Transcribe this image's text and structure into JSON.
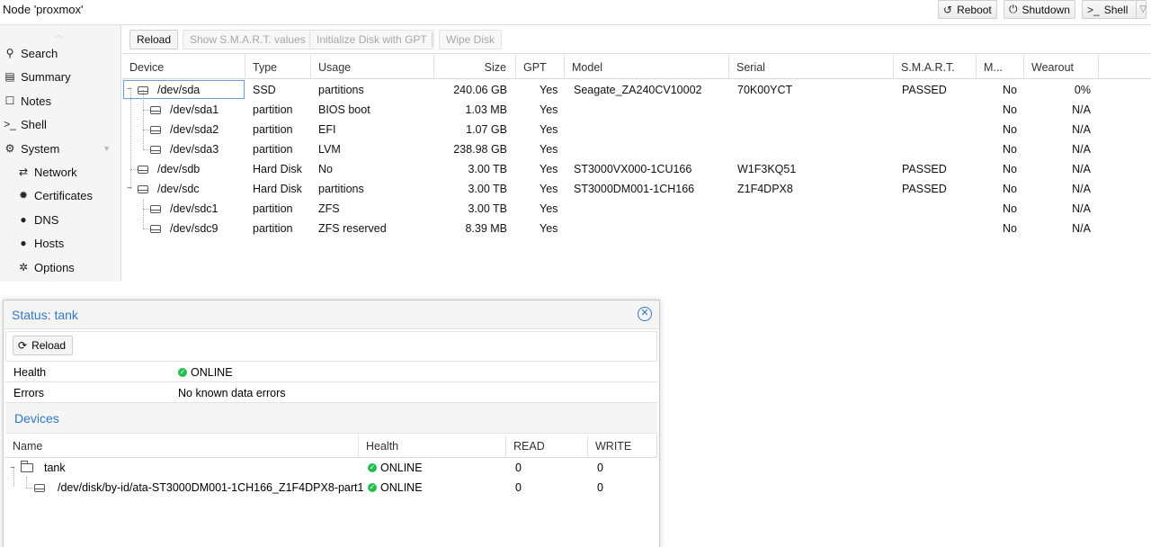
{
  "header": {
    "title": "Node 'proxmox'",
    "buttons": {
      "reboot": "Reboot",
      "shutdown": "Shutdown",
      "shell": "Shell"
    }
  },
  "sidebar": {
    "items": [
      {
        "label": "Search",
        "icon": "search-icon"
      },
      {
        "label": "Summary",
        "icon": "book-icon"
      },
      {
        "label": "Notes",
        "icon": "notes-icon"
      },
      {
        "label": "Shell",
        "icon": "terminal-icon"
      },
      {
        "label": "System",
        "icon": "gears-icon"
      },
      {
        "label": "Network",
        "icon": "network-icon"
      },
      {
        "label": "Certificates",
        "icon": "certificate-icon"
      },
      {
        "label": "DNS",
        "icon": "globe-icon"
      },
      {
        "label": "Hosts",
        "icon": "globe-icon"
      },
      {
        "label": "Options",
        "icon": "gear-icon"
      }
    ]
  },
  "toolbar": {
    "reload": "Reload",
    "smart": "Show S.M.A.R.T. values",
    "init_gpt": "Initialize Disk with GPT",
    "wipe": "Wipe Disk"
  },
  "disk_columns": {
    "device": "Device",
    "type": "Type",
    "usage": "Usage",
    "size": "Size",
    "gpt": "GPT",
    "model": "Model",
    "serial": "Serial",
    "smart": "S.M.A.R.T.",
    "mounted": "M...",
    "wearout": "Wearout"
  },
  "disks": [
    {
      "device": "/dev/sda",
      "type": "SSD",
      "usage": "partitions",
      "size": "240.06 GB",
      "gpt": "Yes",
      "model": "Seagate_ZA240CV10002",
      "serial": "70K00YCT",
      "smart": "PASSED",
      "mounted": "No",
      "wearout": "0%"
    },
    {
      "device": "/dev/sda1",
      "type": "partition",
      "usage": "BIOS boot",
      "size": "1.03 MB",
      "gpt": "Yes",
      "model": "",
      "serial": "",
      "smart": "",
      "mounted": "No",
      "wearout": "N/A"
    },
    {
      "device": "/dev/sda2",
      "type": "partition",
      "usage": "EFI",
      "size": "1.07 GB",
      "gpt": "Yes",
      "model": "",
      "serial": "",
      "smart": "",
      "mounted": "No",
      "wearout": "N/A"
    },
    {
      "device": "/dev/sda3",
      "type": "partition",
      "usage": "LVM",
      "size": "238.98 GB",
      "gpt": "Yes",
      "model": "",
      "serial": "",
      "smart": "",
      "mounted": "No",
      "wearout": "N/A"
    },
    {
      "device": "/dev/sdb",
      "type": "Hard Disk",
      "usage": "No",
      "size": "3.00 TB",
      "gpt": "Yes",
      "model": "ST3000VX000-1CU166",
      "serial": "W1F3KQ51",
      "smart": "PASSED",
      "mounted": "No",
      "wearout": "N/A"
    },
    {
      "device": "/dev/sdc",
      "type": "Hard Disk",
      "usage": "partitions",
      "size": "3.00 TB",
      "gpt": "Yes",
      "model": "ST3000DM001-1CH166",
      "serial": "Z1F4DPX8",
      "smart": "PASSED",
      "mounted": "No",
      "wearout": "N/A"
    },
    {
      "device": "/dev/sdc1",
      "type": "partition",
      "usage": "ZFS",
      "size": "3.00 TB",
      "gpt": "Yes",
      "model": "",
      "serial": "",
      "smart": "",
      "mounted": "No",
      "wearout": "N/A"
    },
    {
      "device": "/dev/sdc9",
      "type": "partition",
      "usage": "ZFS reserved",
      "size": "8.39 MB",
      "gpt": "Yes",
      "model": "",
      "serial": "",
      "smart": "",
      "mounted": "No",
      "wearout": "N/A"
    }
  ],
  "status_window": {
    "title": "Status: tank",
    "reload": "Reload",
    "health_label": "Health",
    "health_value": "ONLINE",
    "errors_label": "Errors",
    "errors_value": "No known data errors",
    "devices_title": "Devices",
    "columns": {
      "name": "Name",
      "health": "Health",
      "read": "READ",
      "write": "WRITE"
    },
    "devices": [
      {
        "name": "tank",
        "health": "ONLINE",
        "read": "0",
        "write": "0"
      },
      {
        "name": "/dev/disk/by-id/ata-ST3000DM001-1CH166_Z1F4DPX8-part1",
        "health": "ONLINE",
        "read": "0",
        "write": "0"
      }
    ]
  },
  "colors": {
    "accent": "#3077c5",
    "ok": "#21bf4b",
    "selection": "#5fa2dd"
  }
}
